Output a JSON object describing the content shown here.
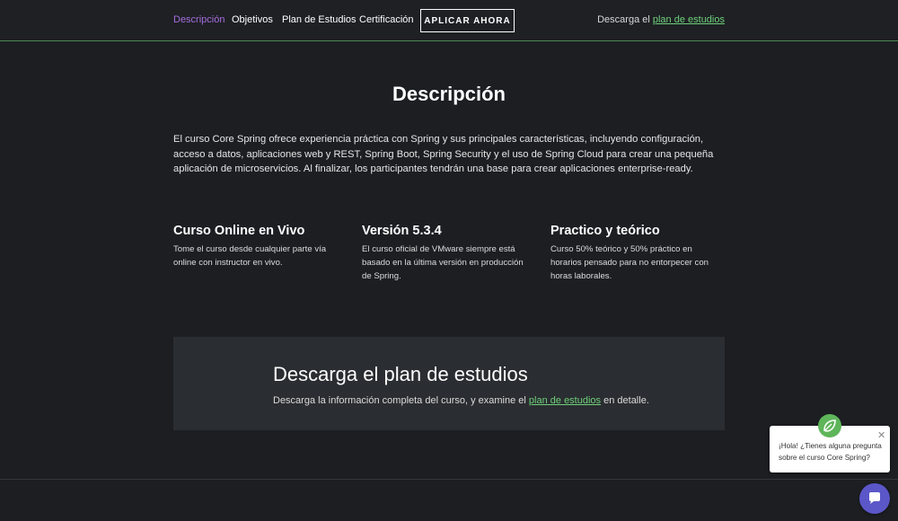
{
  "nav": {
    "items": [
      {
        "label": "Descripción",
        "active": true
      },
      {
        "label": "Objetivos",
        "active": false
      },
      {
        "label": "Plan de Estudios",
        "active": false
      },
      {
        "label": "Certificación",
        "active": false
      }
    ],
    "apply_button": "APLICAR AHORA",
    "download_prefix": "Descarga el",
    "download_link": "plan de estudios"
  },
  "main": {
    "title": "Descripción",
    "intro": "El curso Core Spring ofrece experiencia práctica con Spring y sus principales características, incluyendo configuración, acceso a datos, aplicaciones web y REST, Spring Boot, Spring Security y el uso de Spring Cloud para crear una pequeña aplicación de microservicios. Al finalizar, los participantes tendrán una base para crear aplicaciones enterprise-ready.",
    "features": [
      {
        "title": "Curso Online en Vivo",
        "text": "Tome el curso desde cualquier parte vía online con instructor en vivo."
      },
      {
        "title": "Versión 5.3.4",
        "text": "El curso oficial de VMware siempre está basado en la última versión en producción de Spring."
      },
      {
        "title": "Practico y teórico",
        "text": "Curso 50% teórico y 50% práctico en horarios pensado para no entorpecer con horas laborales."
      }
    ]
  },
  "plan_panel": {
    "title": "Descarga el plan de estudios",
    "text_before": "Descarga la información completa del curso, y examine el",
    "link": "plan de estudios",
    "text_after": "en detalle."
  },
  "chat": {
    "message": "¡Hola! ¿Tienes alguna pregunta sobre el curso Core Spring?",
    "avatar_icon": "spring-leaf-icon",
    "close_icon": "close-icon",
    "launcher_icon": "chat-bubble-icon"
  },
  "colors": {
    "background": "#1c1e22",
    "accent_purple": "#a66dde",
    "link_green": "#6fd07a",
    "chat_launcher": "#5b57c9"
  }
}
